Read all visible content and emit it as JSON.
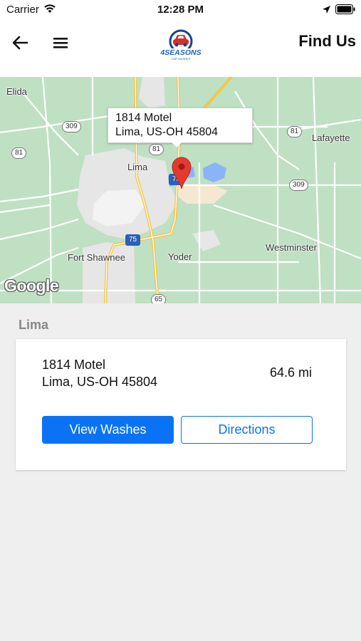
{
  "status_bar": {
    "carrier": "Carrier",
    "time": "12:28 PM"
  },
  "header": {
    "title": "Find Us",
    "logo_text": "4SEASONS",
    "logo_subtext": "CAR WASHES"
  },
  "map": {
    "callout": {
      "line1": "1814 Motel",
      "line2": "Lima, US-OH  45804"
    },
    "places": {
      "elida": "Elida",
      "lafayette": "Lafayette",
      "lima": "Lima",
      "fort_shawnee": "Fort Shawnee",
      "yoder": "Yoder",
      "westminster": "Westminster"
    },
    "routes": {
      "r309_w": "309",
      "r81_w": "81",
      "r81_n": "81",
      "r81_e": "81",
      "r309_e": "309",
      "i75_s": "75",
      "i75_n": "75",
      "r65": "65"
    },
    "attribution": "Google"
  },
  "section": {
    "title": "Lima"
  },
  "location": {
    "name": "1814 Motel",
    "address": "Lima, US-OH  45804",
    "distance": "64.6 mi",
    "view_washes_label": "View Washes",
    "directions_label": "Directions"
  },
  "colors": {
    "accent": "#0a73f5",
    "map_green": "#bfe0c3",
    "pin_red": "#e5392f"
  }
}
